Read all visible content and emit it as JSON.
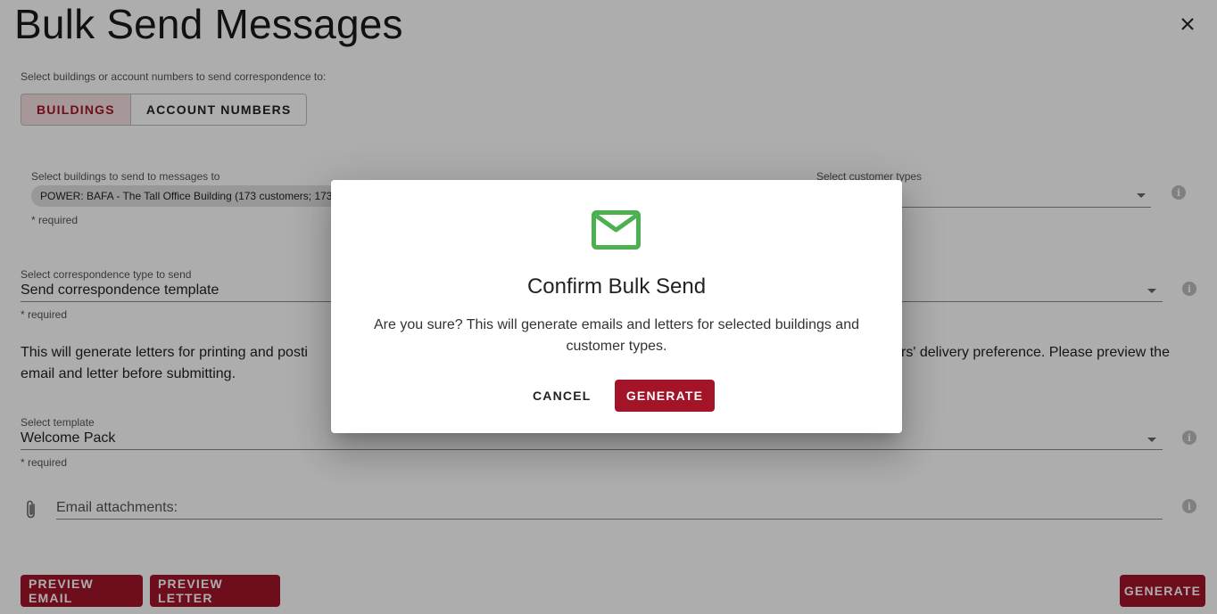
{
  "page": {
    "title": "Bulk Send Messages",
    "select_prompt": "Select buildings or account numbers to send correspondence to:",
    "toggle": {
      "buildings_label": "BUILDINGS",
      "account_numbers_label": "ACCOUNT NUMBERS",
      "selected": "BUILDINGS"
    },
    "buildings_field": {
      "label": "Select buildings to send to messages to",
      "chip": "POWER: BAFA - The Tall Office Building (173 customers; 173",
      "required": "* required"
    },
    "customer_types_field": {
      "label": "Select customer types"
    },
    "correspondence_field": {
      "label": "Select correspondence type to send",
      "value": "Send correspondence template",
      "required": "* required"
    },
    "description": {
      "left": "This will generate letters for printing and posti",
      "right": "rs' delivery preference. Please preview the",
      "line2": "email and letter before submitting."
    },
    "template_field": {
      "label": "Select template",
      "value": "Welcome Pack",
      "required": "* required"
    },
    "attachments": {
      "placeholder": "Email attachments:"
    },
    "buttons": {
      "preview_email": "PREVIEW EMAIL",
      "preview_letter": "PREVIEW LETTER",
      "generate": "GENERATE"
    }
  },
  "dialog": {
    "icon": "mail-icon",
    "title": "Confirm Bulk Send",
    "body": "Are you sure? This will generate emails and letters for selected buildings and customer types.",
    "cancel_label": "CANCEL",
    "generate_label": "GENERATE"
  },
  "colors": {
    "accent": "#a31428",
    "mail_icon": "#4caf50",
    "toggle_active_bg": "#f5dfe2"
  }
}
